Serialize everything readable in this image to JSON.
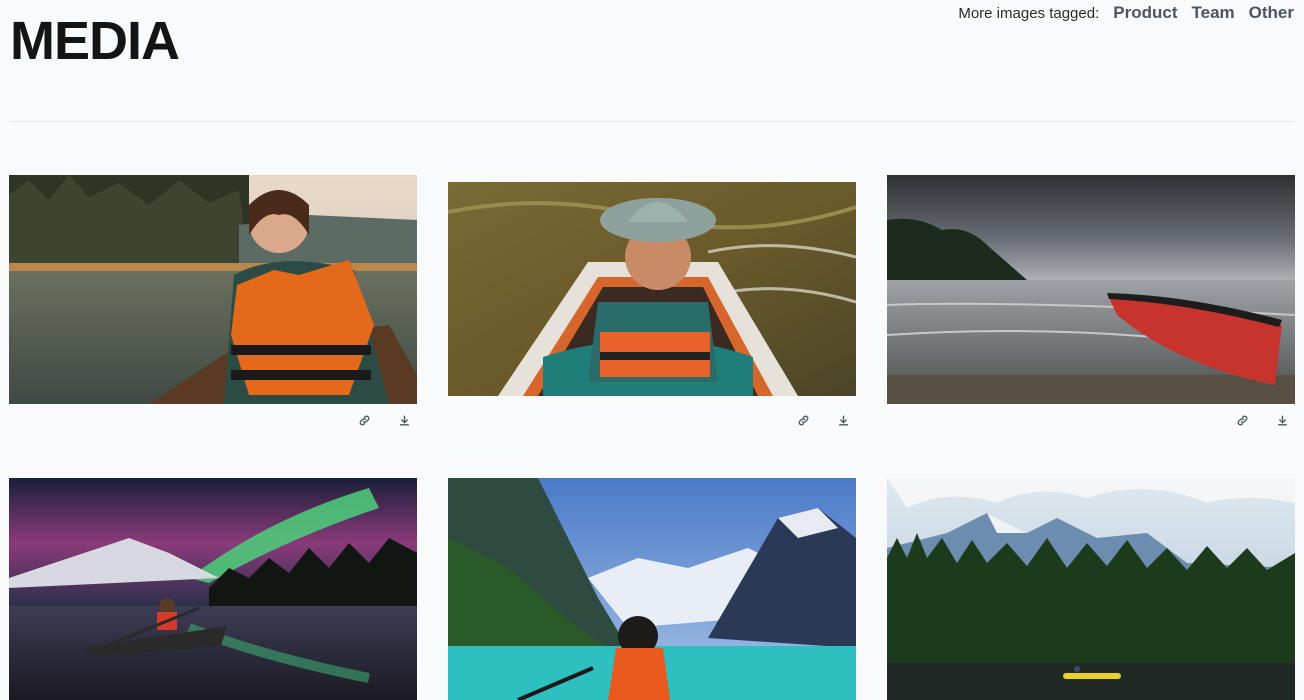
{
  "header": {
    "title": "MEDIA",
    "tags_label": "More images tagged:",
    "tags": [
      "Product",
      "Team",
      "Other"
    ]
  },
  "images": [
    {
      "name": "Smiling woman in orange life vest in canoe on lake",
      "actions": [
        "link-icon",
        "download-icon"
      ]
    },
    {
      "name": "Woman in sun hat and life vest in kayak",
      "actions": [
        "link-icon",
        "download-icon"
      ]
    },
    {
      "name": "Red canoe on lake under stormy sky",
      "actions": [
        "link-icon",
        "download-icon"
      ]
    },
    {
      "name": "Kayaker under northern lights",
      "actions": []
    },
    {
      "name": "Kayaker on turquoise mountain lake",
      "actions": []
    },
    {
      "name": "Yellow kayak below forest and mountains",
      "actions": []
    }
  ],
  "colors": {
    "background": "#f8fafc",
    "title": "#141414",
    "tag_link": "#4b5563",
    "icon": "#4b5563"
  }
}
